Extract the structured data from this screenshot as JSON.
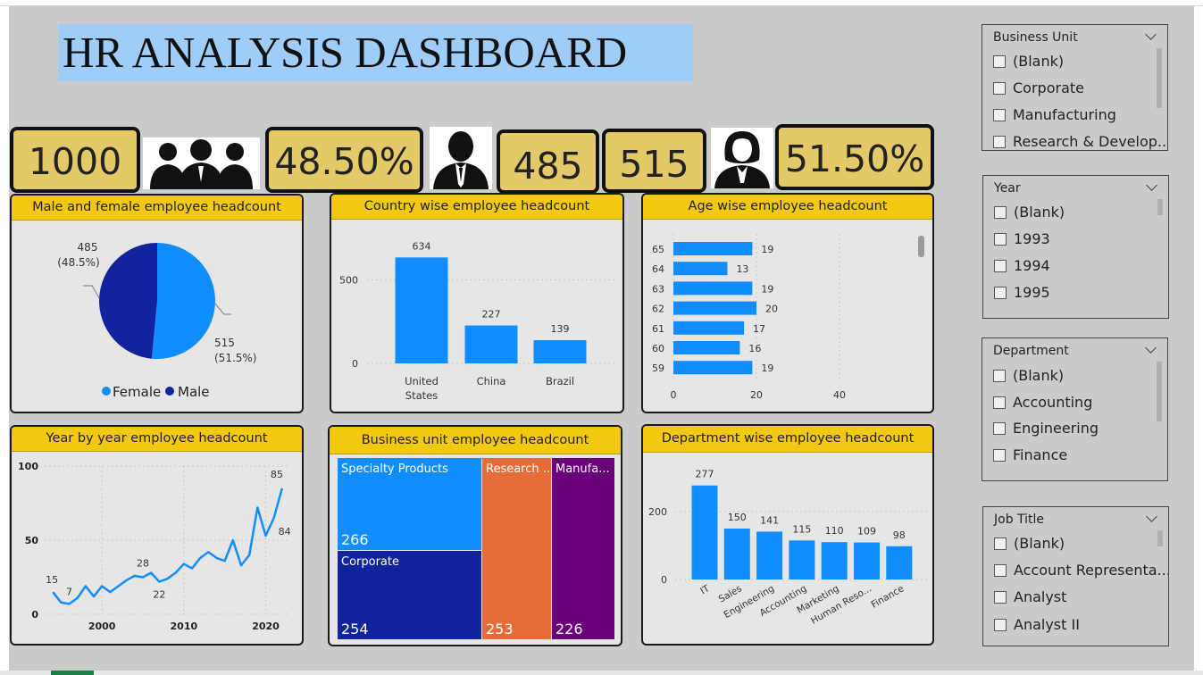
{
  "title": "HR ANALYSIS DASHBOARD",
  "kpis": {
    "total_employees": "1000",
    "male_pct": "48.50%",
    "male_count": "485",
    "female_count": "515",
    "female_pct": "51.50%"
  },
  "icons": {
    "group": "people-group-icon",
    "male": "male-employee-icon",
    "female": "female-employee-icon"
  },
  "colors": {
    "accent": "#f2c811",
    "series_blue": "#118dff",
    "navy": "#12239e",
    "orange": "#e66c37",
    "purple": "#6b007b",
    "kpi_bg": "#e3c968",
    "title_bg": "#9fcdf8"
  },
  "cards": {
    "gender": "Male and female employee headcount",
    "country": "Country wise employee headcount",
    "age": "Age wise employee headcount",
    "year": "Year by year employee headcount",
    "bu": "Business unit employee headcount",
    "dept": "Department wise employee headcount"
  },
  "pie_labels": {
    "male_value": "485",
    "male_pct": "(48.5%)",
    "female_value": "515",
    "female_pct": "(51.5%)",
    "legend_female": "Female",
    "legend_male": "Male"
  },
  "treemap": [
    {
      "name": "Specialty Products",
      "value": "266"
    },
    {
      "name": "Corporate",
      "value": "254"
    },
    {
      "name": "Research ...",
      "value": "253"
    },
    {
      "name": "Manufa...",
      "value": "226"
    }
  ],
  "chart_data": [
    {
      "type": "pie",
      "categories": [
        "Female",
        "Male"
      ],
      "values": [
        515,
        485
      ],
      "percent_labels": [
        "(51.5%)",
        "(48.5%)"
      ],
      "legend": "bottom"
    },
    {
      "type": "bar",
      "categories": [
        "United States",
        "China",
        "Brazil"
      ],
      "values": [
        634,
        227,
        139
      ],
      "yticks": [
        0,
        500
      ],
      "ylim": [
        0,
        700
      ]
    },
    {
      "type": "bar",
      "orientation": "horizontal",
      "categories": [
        "65",
        "64",
        "63",
        "62",
        "61",
        "60",
        "59"
      ],
      "values": [
        19,
        13,
        19,
        20,
        17,
        16,
        19
      ],
      "xticks": [
        0,
        20,
        40
      ],
      "xlim": [
        0,
        45
      ]
    },
    {
      "type": "line",
      "x": [
        1994,
        1995,
        1996,
        1997,
        1998,
        1999,
        2000,
        2001,
        2002,
        2003,
        2004,
        2005,
        2006,
        2007,
        2008,
        2009,
        2010,
        2011,
        2012,
        2013,
        2014,
        2015,
        2016,
        2017,
        2018,
        2019,
        2020,
        2021,
        2022
      ],
      "y": [
        15,
        8,
        7,
        11,
        19,
        12,
        19,
        15,
        19,
        23,
        26,
        25,
        28,
        22,
        24,
        28,
        34,
        31,
        38,
        42,
        38,
        36,
        50,
        33,
        40,
        72,
        53,
        65,
        85
      ],
      "point_labels": {
        "1994": "15",
        "1996": "7",
        "2005": "28",
        "2007": "22",
        "2021": "84",
        "2022": "85"
      },
      "xticks": [
        2000,
        2010,
        2020
      ],
      "yticks": [
        0,
        50,
        100
      ],
      "xlim": [
        1993,
        2023
      ],
      "ylim": [
        0,
        100
      ]
    },
    {
      "type": "treemap",
      "categories": [
        "Specialty Products",
        "Corporate",
        "Research ...",
        "Manufa..."
      ],
      "values": [
        266,
        254,
        253,
        226
      ]
    },
    {
      "type": "bar",
      "categories": [
        "IT",
        "Sales",
        "Engineering",
        "Accounting",
        "Marketing",
        "Human Reso...",
        "Finance"
      ],
      "values": [
        277,
        150,
        141,
        115,
        110,
        109,
        98
      ],
      "yticks": [
        0,
        200
      ],
      "ylim": [
        0,
        300
      ]
    }
  ],
  "slicers": [
    {
      "title": "Business Unit",
      "items": [
        "(Blank)",
        "Corporate",
        "Manufacturing",
        "Research & Develop..."
      ]
    },
    {
      "title": "Year",
      "items": [
        "(Blank)",
        "1993",
        "1994",
        "1995"
      ]
    },
    {
      "title": "Department",
      "items": [
        "(Blank)",
        "Accounting",
        "Engineering",
        "Finance"
      ]
    },
    {
      "title": "Job Title",
      "items": [
        "(Blank)",
        "Account Representa...",
        "Analyst",
        "Analyst II"
      ]
    }
  ]
}
